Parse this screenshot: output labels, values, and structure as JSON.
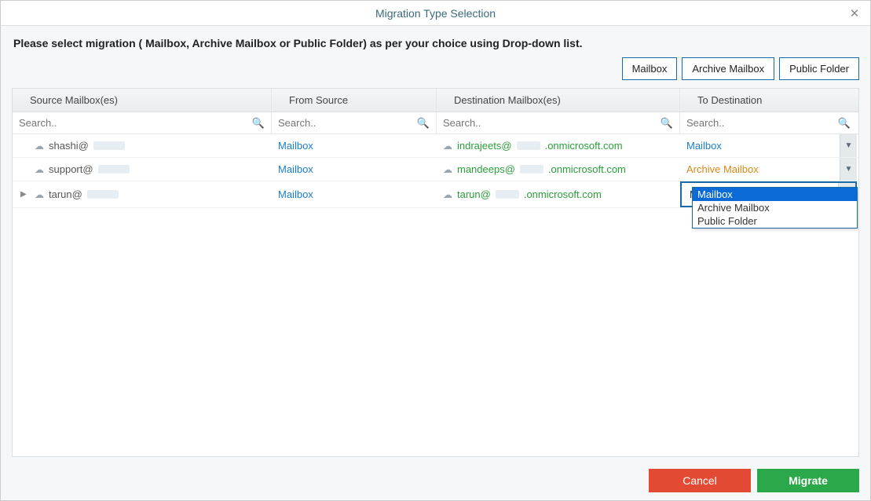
{
  "titlebar": {
    "title": "Migration Type Selection"
  },
  "instruction": "Please select migration ( Mailbox, Archive Mailbox or Public Folder) as per your choice using Drop-down list.",
  "filterButtons": {
    "mailbox": "Mailbox",
    "archive": "Archive Mailbox",
    "public": "Public Folder"
  },
  "columns": {
    "source": "Source Mailbox(es)",
    "fromSource": "From Source",
    "destination": "Destination Mailbox(es)",
    "toDestination": "To Destination"
  },
  "search": {
    "placeholder": "Search.."
  },
  "rows": [
    {
      "source_prefix": "shashi@",
      "fromSource": "Mailbox",
      "dest_prefix": "indrajeets@",
      "dest_suffix": ".onmicrosoft.com",
      "toDestination": "Mailbox",
      "destColor": "blue",
      "expandable": false
    },
    {
      "source_prefix": "support@",
      "fromSource": "Mailbox",
      "dest_prefix": "mandeeps@",
      "dest_suffix": ".onmicrosoft.com",
      "toDestination": "Archive Mailbox",
      "destColor": "orange",
      "expandable": false
    },
    {
      "source_prefix": "tarun@",
      "fromSource": "Mailbox",
      "dest_prefix": "tarun@",
      "dest_suffix": ".onmicrosoft.com",
      "toDestination": "Mailbox",
      "destColor": "black",
      "expandable": true,
      "dropdownOpen": true
    }
  ],
  "dropdown": {
    "options": [
      "Mailbox",
      "Archive Mailbox",
      "Public Folder"
    ],
    "selected": "Mailbox"
  },
  "footer": {
    "cancel": "Cancel",
    "migrate": "Migrate"
  }
}
